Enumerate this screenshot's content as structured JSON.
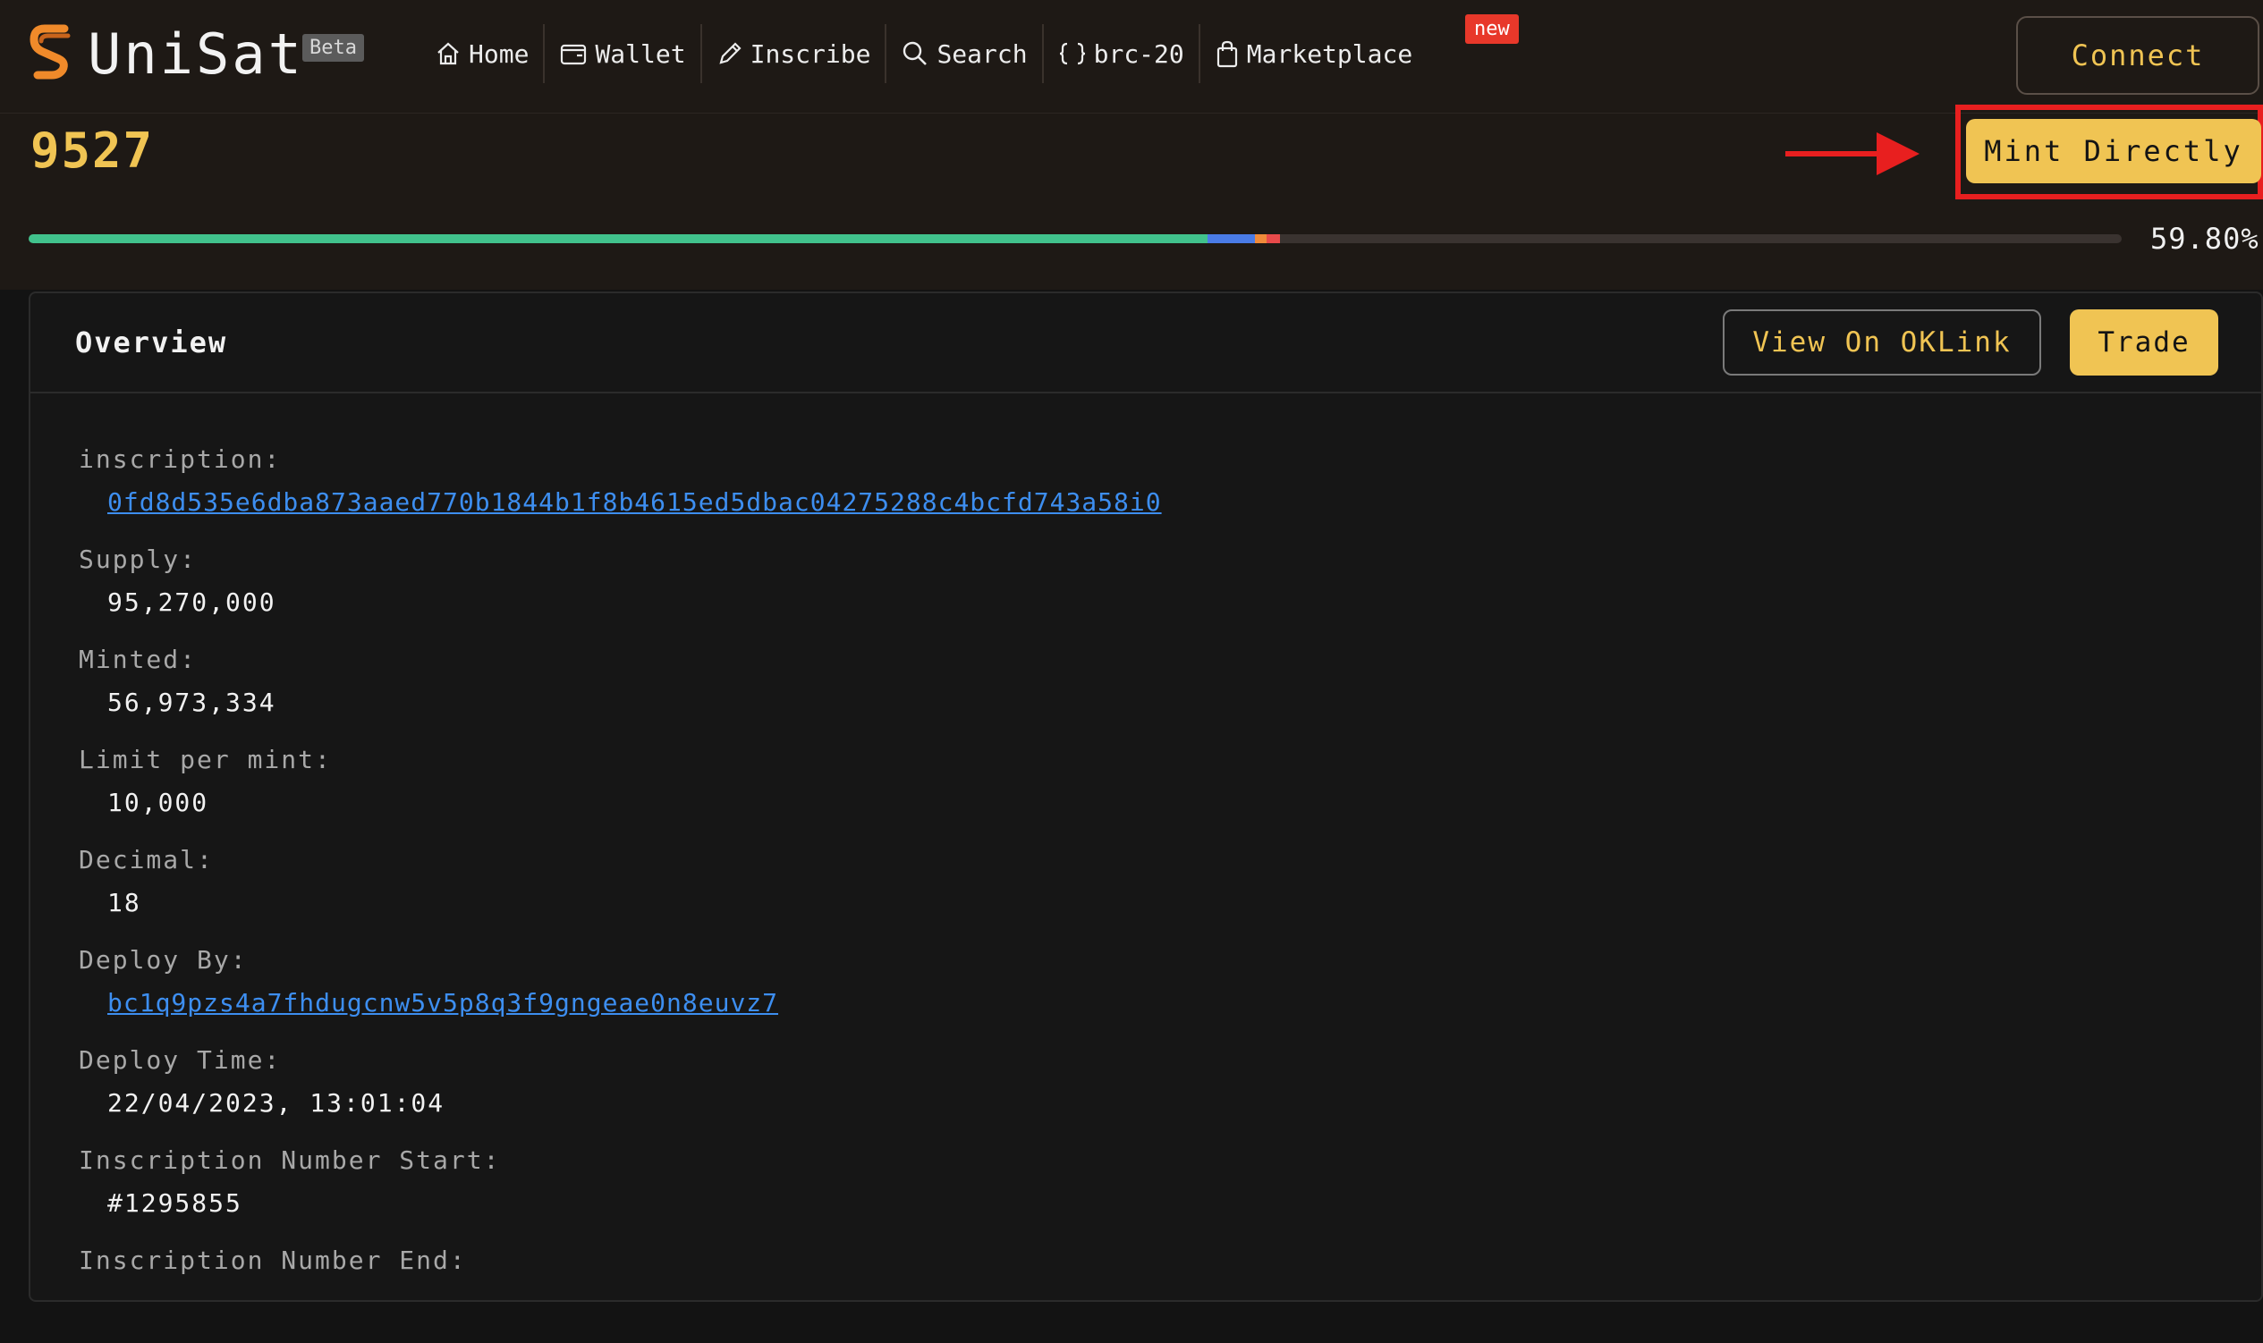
{
  "app": {
    "brand": "UniSat",
    "beta_label": "Beta",
    "connect_label": "Connect"
  },
  "nav": {
    "items": [
      {
        "label": "Home",
        "icon": "home-icon"
      },
      {
        "label": "Wallet",
        "icon": "wallet-icon"
      },
      {
        "label": "Inscribe",
        "icon": "pencil-icon"
      },
      {
        "label": "Search",
        "icon": "search-icon"
      },
      {
        "label": "brc-20",
        "icon": "braces-icon"
      },
      {
        "label": "Marketplace",
        "icon": "bag-icon"
      }
    ],
    "new_badge": "new"
  },
  "token": {
    "name": "9527",
    "mint_label": "Mint Directly",
    "progress_text": "59.80%",
    "progress": 0.598
  },
  "overview": {
    "title": "Overview",
    "oklink_label": "View On OKLink",
    "trade_label": "Trade",
    "fields": [
      {
        "label": "inscription:",
        "value": "0fd8d535e6dba873aaed770b1844b1f8b4615ed5dbac04275288c4bcfd743a58i0",
        "link": true
      },
      {
        "label": "Supply:",
        "value": "95,270,000",
        "link": false
      },
      {
        "label": "Minted:",
        "value": "56,973,334",
        "link": false
      },
      {
        "label": "Limit per mint:",
        "value": "10,000",
        "link": false
      },
      {
        "label": "Decimal:",
        "value": "18",
        "link": false
      },
      {
        "label": "Deploy By:",
        "value": "bc1q9pzs4a7fhdugcnw5v5p8q3f9gngeae0n8euvz7",
        "link": true
      },
      {
        "label": "Deploy Time:",
        "value": "22/04/2023, 13:01:04",
        "link": false
      },
      {
        "label": "Inscription Number Start:",
        "value": "#1295855",
        "link": false
      },
      {
        "label": "Inscription Number End:",
        "value": "",
        "link": false
      }
    ]
  },
  "colors": {
    "accent": "#f0c453",
    "link": "#3d8ef0",
    "badge": "#e8382a",
    "highlight": "#e81f1f",
    "progress_green": "#41c28c"
  }
}
